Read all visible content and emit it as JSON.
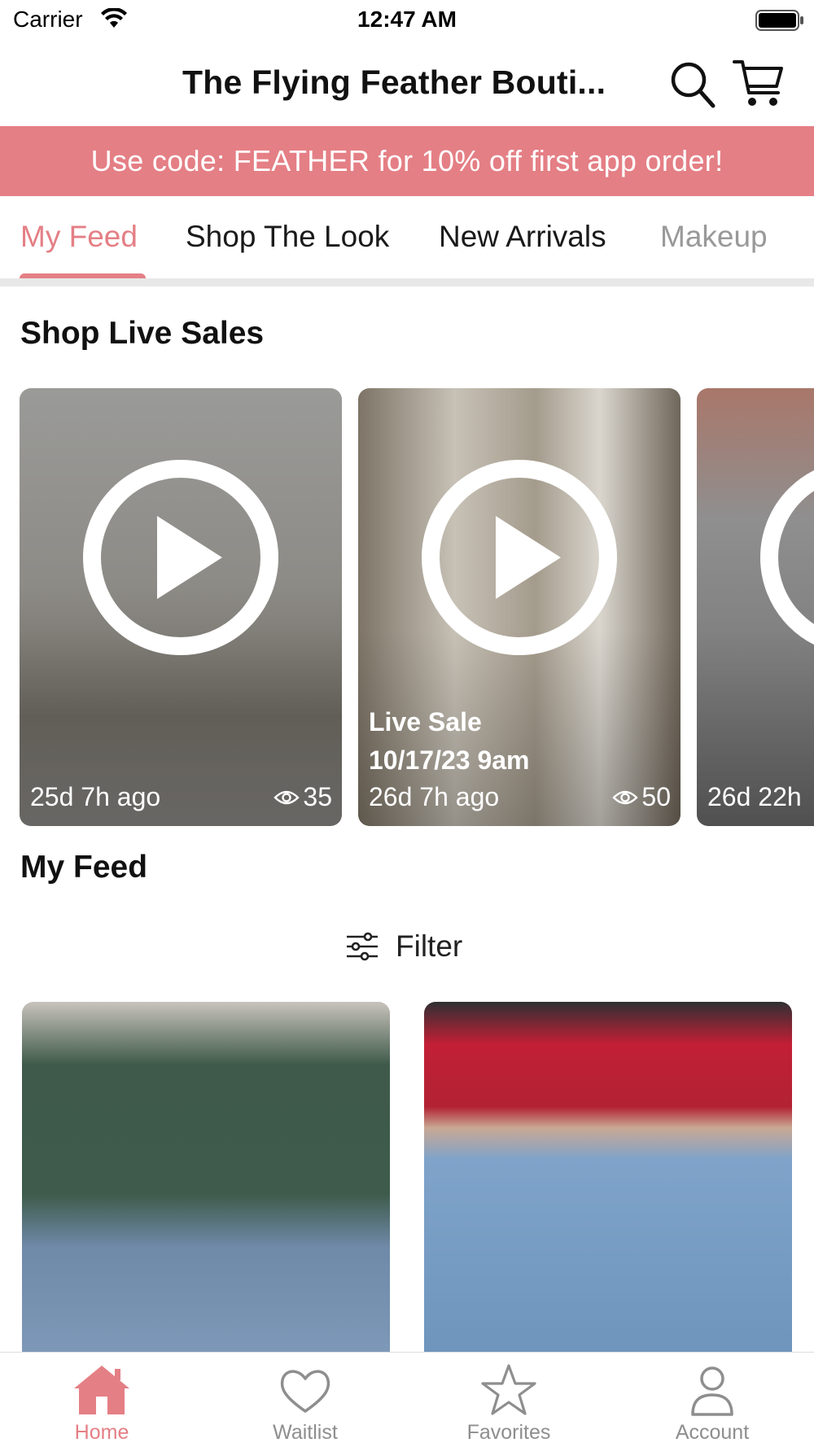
{
  "status_bar": {
    "carrier": "Carrier",
    "time": "12:47 AM"
  },
  "header": {
    "title": "The Flying Feather Bouti...",
    "search_icon": "search-icon",
    "cart_icon": "cart-icon"
  },
  "promo": {
    "text": "Use code: FEATHER for 10% off first app order!"
  },
  "tabs": [
    {
      "label": "My Feed",
      "active": true
    },
    {
      "label": "Shop The Look",
      "active": false
    },
    {
      "label": "New Arrivals",
      "active": false
    },
    {
      "label": "Makeup",
      "active": false
    }
  ],
  "live_sales": {
    "title": "Shop Live Sales",
    "items": [
      {
        "title": "",
        "time_ago": "25d 7h ago",
        "views": "35"
      },
      {
        "title": "Live Sale\n10/17/23 9am",
        "time_ago": "26d 7h ago",
        "views": "50"
      },
      {
        "title": "",
        "time_ago": "26d 22h",
        "views": ""
      }
    ]
  },
  "feed": {
    "title": "My Feed",
    "filter_label": "Filter"
  },
  "tab_bar": {
    "items": [
      {
        "label": "Home",
        "icon": "home-icon",
        "active": true
      },
      {
        "label": "Waitlist",
        "icon": "heart-icon",
        "active": false
      },
      {
        "label": "Favorites",
        "icon": "star-icon",
        "active": false
      },
      {
        "label": "Account",
        "icon": "person-icon",
        "active": false
      }
    ]
  },
  "colors": {
    "accent": "#e47f85",
    "inactive": "#8e8e8e",
    "text": "#111111"
  }
}
